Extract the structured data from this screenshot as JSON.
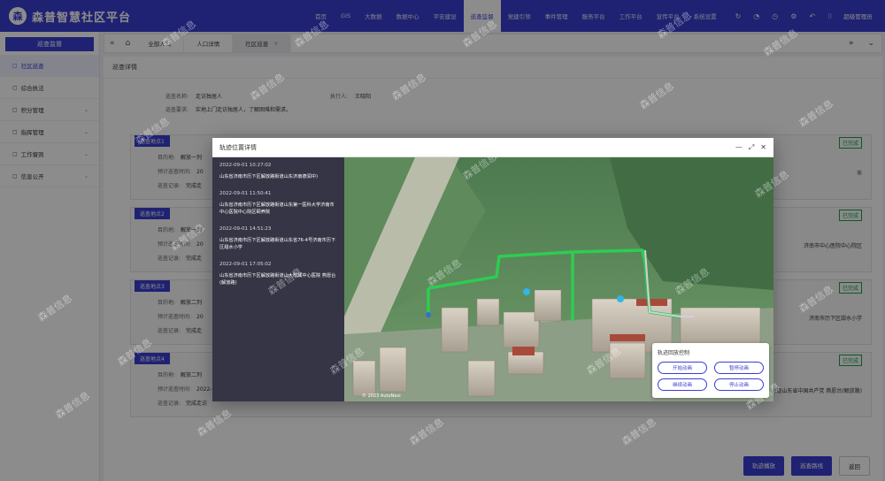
{
  "app": {
    "logo_char": "森",
    "title": "森普智慧社区平台"
  },
  "topnav": [
    {
      "label": "首页",
      "active": false
    },
    {
      "label": "GIS",
      "active": false
    },
    {
      "label": "大数据",
      "active": false
    },
    {
      "label": "数据中心",
      "active": false
    },
    {
      "label": "平安建设",
      "active": false
    },
    {
      "label": "巡查监督",
      "active": true
    },
    {
      "label": "党建引领",
      "active": false
    },
    {
      "label": "事件管理",
      "active": false
    },
    {
      "label": "服务平台",
      "active": false
    },
    {
      "label": "工作平台",
      "active": false
    },
    {
      "label": "宣传平台",
      "active": false
    },
    {
      "label": "系统设置",
      "active": false
    }
  ],
  "top_icons": [
    "refresh-icon",
    "bell-icon",
    "clock-icon",
    "gear-icon",
    "undo-icon",
    "grid-icon"
  ],
  "user": {
    "name": "超级管理员"
  },
  "sidebar": {
    "title": "巡查监督",
    "items": [
      {
        "label": "社区巡查",
        "active": true,
        "has_children": false
      },
      {
        "label": "综合执法",
        "active": false,
        "has_children": false
      },
      {
        "label": "积分管理",
        "active": false,
        "has_children": true
      },
      {
        "label": "指挥管理",
        "active": false,
        "has_children": true
      },
      {
        "label": "工作督则",
        "active": false,
        "has_children": true
      },
      {
        "label": "信息公开",
        "active": false,
        "has_children": true
      }
    ]
  },
  "breadcrumb": {
    "tabs": [
      {
        "label": "全部人口",
        "active": false
      },
      {
        "label": "人口详情",
        "active": false
      },
      {
        "label": "社区巡查",
        "active": true
      }
    ]
  },
  "main": {
    "title": "巡查详情",
    "info": {
      "name_label": "巡查名称:",
      "name_value": "走访独居人",
      "executor_label": "执行人:",
      "executor_value": "王晓阳",
      "req_label": "巡查要求:",
      "req_value": "实地上门走访独居人，了解困难和需求。"
    },
    "cards": [
      {
        "tag": "巡查地点1",
        "status": "已完成",
        "l1": "目的地:",
        "v1": "解放一列",
        "l2": "预计巡查时间:",
        "v2": "20",
        "l3": "巡查记录:",
        "v3": "完成走",
        "right": "市"
      },
      {
        "tag": "巡查地点2",
        "status": "已完成",
        "l1": "目的地:",
        "v1": "解放一列",
        "l2": "预计巡查时间:",
        "v2": "20",
        "l3": "巡查记录:",
        "v3": "完成走",
        "right": "济南市中心医院中心院区"
      },
      {
        "tag": "巡查地点3",
        "status": "已完成",
        "l1": "目的地:",
        "v1": "解放二列",
        "l2": "预计巡查时间:",
        "v2": "20",
        "l3": "巡查记录:",
        "v3": "完成走",
        "right": "济南市历下区甜水小学"
      },
      {
        "tag": "巡查地点4",
        "status": "已完成",
        "l1": "目的地:",
        "v1": "解放二列",
        "l2": "预计巡查时间:",
        "v2": "2022-09-01 16:00:00",
        "l3": "巡查记录:",
        "v3": "完成走访",
        "right": "山东省济南市历下区解放路街道山东省中国共产党 燕愿台(解放路)"
      }
    ],
    "buttons": {
      "track": "轨迹播放",
      "reroute": "巡查路线",
      "back": "返回"
    }
  },
  "modal": {
    "title": "轨迹位置详情",
    "tracks": [
      {
        "time": "2022-09-01 10:27:02",
        "address": "山东省济南市历下区解放路街道山东济南德润中)"
      },
      {
        "time": "2022-09-01 11:50:41",
        "address": "山东省济南市历下区解放路街道山东第一医科大学济南市中心医院中心院区颐养院"
      },
      {
        "time": "2022-09-01 14:51:23",
        "address": "山东省济南市历下区解放路街道山东省76-4号济南市历下区甜水小学"
      },
      {
        "time": "2022-09-01 17:05:02",
        "address": "山东省济南市历下区解放路街道山大附属中心医院 燕愿台(解放路)"
      }
    ],
    "control": {
      "title": "轨迹回放控制",
      "buttons": [
        "开始动画",
        "暂停动画",
        "继续动画",
        "停止动画"
      ]
    },
    "map_credit": "© 2023 AutoNavi"
  },
  "watermark": "森普信息"
}
